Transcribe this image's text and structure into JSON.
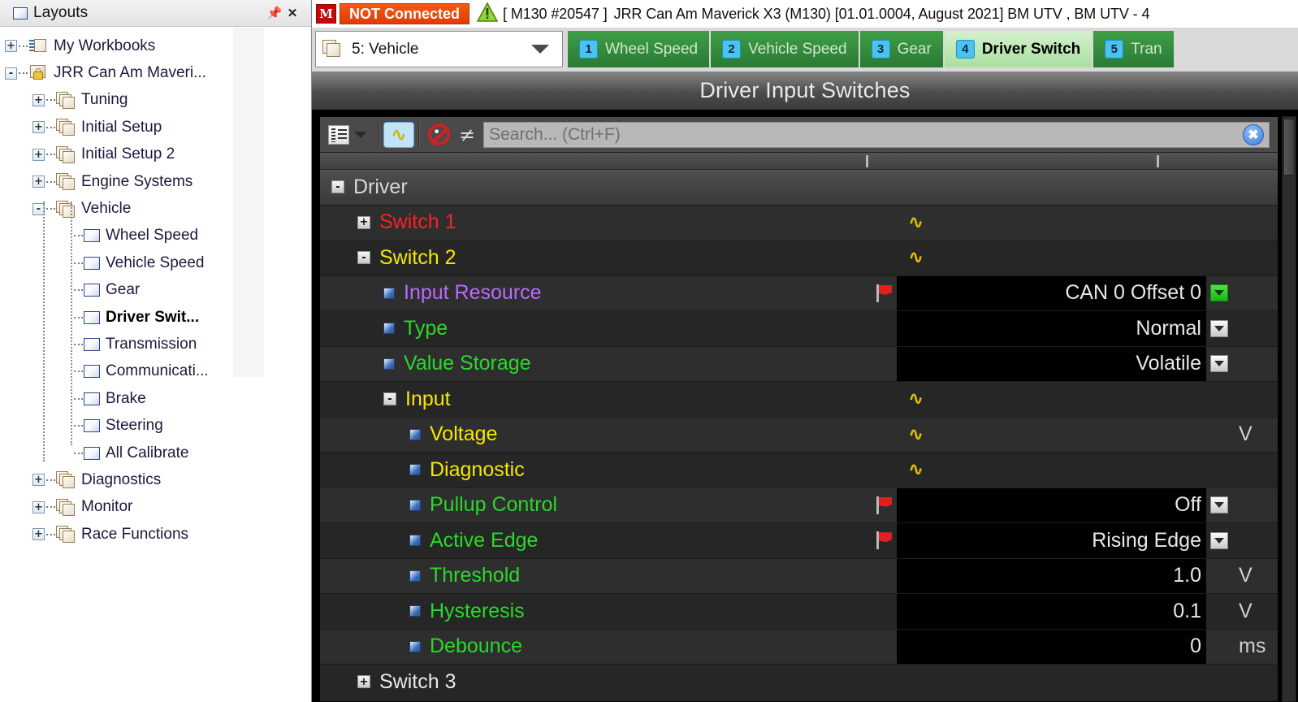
{
  "left_panel": {
    "title": "Layouts",
    "pin_icon": "pin-icon",
    "close_icon": "close-icon",
    "tree": [
      {
        "label": "My Workbooks",
        "indent": 0,
        "expander": "+",
        "icon": "workbook-icon",
        "selected": false
      },
      {
        "label": "JRR Can Am Maveri...",
        "indent": 0,
        "expander": "-",
        "icon": "locked-book-icon",
        "selected": false
      },
      {
        "label": "Tuning",
        "indent": 1,
        "expander": "+",
        "icon": "stack-icon",
        "selected": false
      },
      {
        "label": "Initial Setup",
        "indent": 1,
        "expander": "+",
        "icon": "stack-icon",
        "selected": false
      },
      {
        "label": "Initial Setup 2",
        "indent": 1,
        "expander": "+",
        "icon": "stack-icon",
        "selected": false
      },
      {
        "label": "Engine Systems",
        "indent": 1,
        "expander": "+",
        "icon": "stack-icon",
        "selected": false
      },
      {
        "label": "Vehicle",
        "indent": 1,
        "expander": "-",
        "icon": "stack-icon",
        "selected": false
      },
      {
        "label": "Wheel Speed",
        "indent": 2,
        "expander": "",
        "icon": "page-icon",
        "selected": false
      },
      {
        "label": "Vehicle Speed",
        "indent": 2,
        "expander": "",
        "icon": "page-icon",
        "selected": false
      },
      {
        "label": "Gear",
        "indent": 2,
        "expander": "",
        "icon": "page-icon",
        "selected": false
      },
      {
        "label": "Driver Swit...",
        "indent": 2,
        "expander": "",
        "icon": "page-icon",
        "selected": true
      },
      {
        "label": "Transmission",
        "indent": 2,
        "expander": "",
        "icon": "page-icon",
        "selected": false
      },
      {
        "label": "Communicati...",
        "indent": 2,
        "expander": "",
        "icon": "page-icon",
        "selected": false
      },
      {
        "label": "Brake",
        "indent": 2,
        "expander": "",
        "icon": "page-icon",
        "selected": false
      },
      {
        "label": "Steering",
        "indent": 2,
        "expander": "",
        "icon": "page-icon",
        "selected": false
      },
      {
        "label": "All Calibrate",
        "indent": 2,
        "expander": "",
        "icon": "page-icon",
        "selected": false
      },
      {
        "label": "Diagnostics",
        "indent": 1,
        "expander": "+",
        "icon": "stack-icon",
        "selected": false
      },
      {
        "label": "Monitor",
        "indent": 1,
        "expander": "+",
        "icon": "stack-icon",
        "selected": false
      },
      {
        "label": "Race Functions",
        "indent": 1,
        "expander": "+",
        "icon": "stack-icon",
        "selected": false
      }
    ]
  },
  "topbar": {
    "logo_text": "M",
    "connection_status": "NOT Connected",
    "warning_icon": "warning-triangle-icon",
    "device_id": "[ M130 #20547 ]",
    "project_title": "JRR Can Am Maverick X3 (M130) [01.01.0004, August 2021] BM UTV , BM UTV - 4"
  },
  "tabbar": {
    "page_select": {
      "label": "5: Vehicle",
      "icon": "pages-icon",
      "caret": "chevron-down-icon"
    },
    "tabs": [
      {
        "num": "1",
        "label": "Wheel Speed",
        "active": false
      },
      {
        "num": "2",
        "label": "Vehicle Speed",
        "active": false
      },
      {
        "num": "3",
        "label": "Gear",
        "active": false
      },
      {
        "num": "4",
        "label": "Driver Switch",
        "active": true
      },
      {
        "num": "5",
        "label": "Tran",
        "active": false
      }
    ]
  },
  "pane": {
    "title": "Driver Input Switches"
  },
  "toolbar": {
    "list_view_icon": "list-view-icon",
    "caret_icon": "chevron-down-icon",
    "waveform_icon": "waveform-icon",
    "noentry_icon": "no-entry-icon",
    "notequal_icon": "not-equal-icon",
    "search_placeholder": "Search... (Ctrl+F)",
    "search_value": "",
    "clear_icon": "clear-x-icon"
  },
  "grid": {
    "rows": [
      {
        "label": "Driver",
        "indent": 0,
        "expander": "-",
        "color": "#d8d8d8",
        "marker": "none",
        "flag": false,
        "value": "",
        "value_kind": "none",
        "unit": "",
        "dropdown": "none"
      },
      {
        "label": "Switch 1",
        "indent": 1,
        "expander": "+",
        "color": "#ff2020",
        "marker": "none",
        "flag": false,
        "value": "wave",
        "value_kind": "wave",
        "unit": "",
        "dropdown": "none"
      },
      {
        "label": "Switch 2",
        "indent": 1,
        "expander": "-",
        "color": "#f5e800",
        "marker": "none",
        "flag": false,
        "value": "wave",
        "value_kind": "wave",
        "unit": "",
        "dropdown": "none"
      },
      {
        "label": "Input Resource",
        "indent": 2,
        "expander": "",
        "color": "#b86cff",
        "marker": "bullet",
        "flag": true,
        "value": "CAN 0 Offset 0",
        "value_kind": "text",
        "unit": "",
        "dropdown": "green"
      },
      {
        "label": "Type",
        "indent": 2,
        "expander": "",
        "color": "#2bd82b",
        "marker": "bullet",
        "flag": false,
        "value": "Normal",
        "value_kind": "text",
        "unit": "",
        "dropdown": "grey"
      },
      {
        "label": "Value Storage",
        "indent": 2,
        "expander": "",
        "color": "#2bd82b",
        "marker": "bullet",
        "flag": false,
        "value": "Volatile",
        "value_kind": "text",
        "unit": "",
        "dropdown": "grey"
      },
      {
        "label": "Input",
        "indent": 2,
        "expander": "-",
        "color": "#f5e800",
        "marker": "none",
        "flag": false,
        "value": "wave",
        "value_kind": "wave",
        "unit": "",
        "dropdown": "none"
      },
      {
        "label": "Voltage",
        "indent": 3,
        "expander": "",
        "color": "#f5e800",
        "marker": "bullet",
        "flag": false,
        "value": "wave",
        "value_kind": "wave",
        "unit": "V",
        "dropdown": "none"
      },
      {
        "label": "Diagnostic",
        "indent": 3,
        "expander": "",
        "color": "#f5e800",
        "marker": "bullet",
        "flag": false,
        "value": "wave",
        "value_kind": "wave",
        "unit": "",
        "dropdown": "none"
      },
      {
        "label": "Pullup Control",
        "indent": 3,
        "expander": "",
        "color": "#2bd82b",
        "marker": "bullet",
        "flag": true,
        "value": "Off",
        "value_kind": "text",
        "unit": "",
        "dropdown": "grey"
      },
      {
        "label": "Active Edge",
        "indent": 3,
        "expander": "",
        "color": "#2bd82b",
        "marker": "bullet",
        "flag": true,
        "value": "Rising Edge",
        "value_kind": "text",
        "unit": "",
        "dropdown": "grey"
      },
      {
        "label": "Threshold",
        "indent": 3,
        "expander": "",
        "color": "#2bd82b",
        "marker": "bullet",
        "flag": false,
        "value": "1.0",
        "value_kind": "text",
        "unit": "V",
        "dropdown": "none"
      },
      {
        "label": "Hysteresis",
        "indent": 3,
        "expander": "",
        "color": "#2bd82b",
        "marker": "bullet",
        "flag": false,
        "value": "0.1",
        "value_kind": "text",
        "unit": "V",
        "dropdown": "none"
      },
      {
        "label": "Debounce",
        "indent": 3,
        "expander": "",
        "color": "#2bd82b",
        "marker": "bullet",
        "flag": false,
        "value": "0",
        "value_kind": "text",
        "unit": "ms",
        "dropdown": "none"
      },
      {
        "label": "Switch 3",
        "indent": 1,
        "expander": "+",
        "color": "#e9e9e9",
        "marker": "none",
        "flag": false,
        "value": "",
        "value_kind": "none",
        "unit": "",
        "dropdown": "none"
      }
    ]
  },
  "colors": {
    "accent_green": "#2bd82b",
    "accent_yellow": "#f5e800",
    "accent_red": "#ff2020",
    "accent_purple": "#b86cff",
    "status_orange": "#e23b06",
    "tab_green": "#2a7a33"
  }
}
